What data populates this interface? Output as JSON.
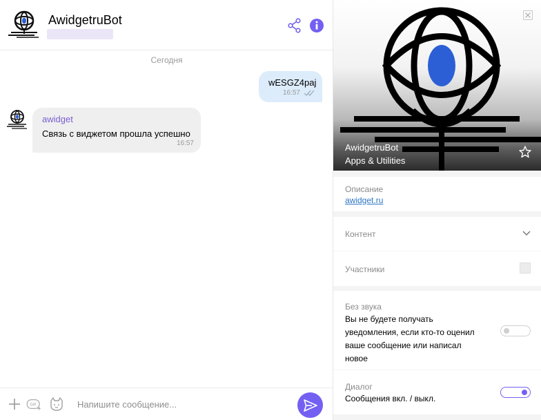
{
  "header": {
    "title": "AwidgetruBot"
  },
  "chat": {
    "date_divider": "Сегодня",
    "outgoing": {
      "text": "wESGZ4paj",
      "time": "16:57"
    },
    "incoming": {
      "sender": "awidget",
      "text": "Связь с виджетом прошла успешно",
      "time": "16:57"
    }
  },
  "composer": {
    "placeholder": "Напишите сообщение..."
  },
  "info_panel": {
    "name": "AwidgetruBot",
    "category": "Apps & Utilities",
    "description_label": "Описание",
    "description_link": "awidget.ru",
    "content_label": "Контент",
    "members_label": "Участники",
    "mute_label": "Без звука",
    "mute_text_lines": [
      "Вы не будете получать",
      "уведомления, если кто-то оценил",
      "ваше сообщение или написал",
      "новое"
    ],
    "mute_enabled": false,
    "dialog_label": "Диалог",
    "dialog_text": "Сообщения вкл. / выкл.",
    "dialog_enabled": true
  },
  "colors": {
    "accent": "#7360f2",
    "outgoing_bubble": "#dcecfb",
    "incoming_bubble": "#efefef",
    "link": "#2f76c4",
    "sender_name": "#7a5fd0"
  },
  "icons": [
    "bot-logo-icon",
    "share-icon",
    "info-icon",
    "double-check-icon",
    "plus-icon",
    "gif-icon",
    "sticker-icon",
    "send-icon",
    "close-icon",
    "star-icon",
    "chevron-down-icon"
  ]
}
